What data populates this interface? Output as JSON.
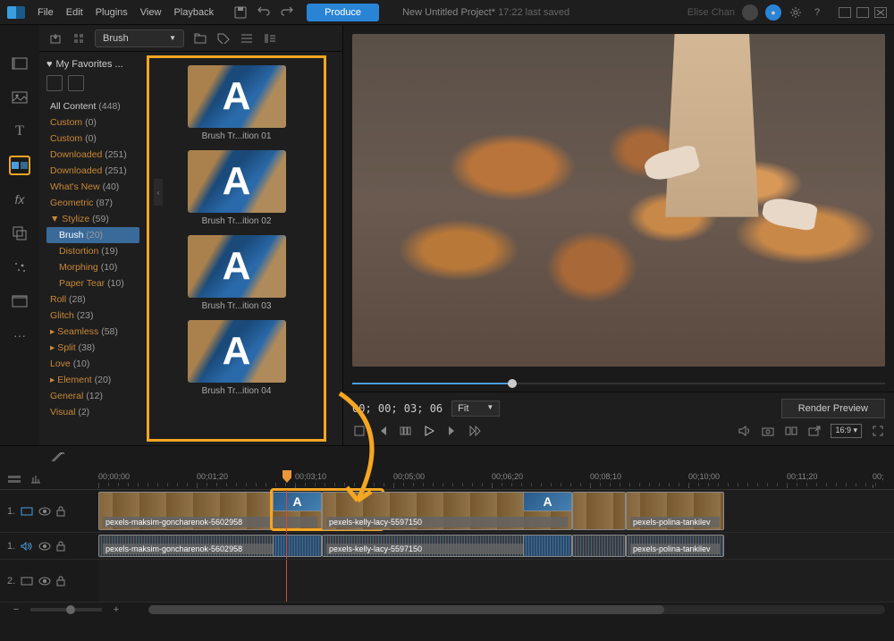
{
  "menubar": {
    "items": [
      "File",
      "Edit",
      "Plugins",
      "View",
      "Playback"
    ],
    "produce": "Produce",
    "title": "New Untitled Project*",
    "saved": "17:22 last saved",
    "user": "Elise Chan"
  },
  "library": {
    "dropdown": "Brush",
    "favorites": "My Favorites ...",
    "all_content": "All Content",
    "all_count": "(448)",
    "categories": [
      {
        "label": "Custom",
        "count": "(0)"
      },
      {
        "label": "Custom",
        "count": "(0)"
      },
      {
        "label": "Downloaded",
        "count": "(251)"
      },
      {
        "label": "Downloaded",
        "count": "(251)"
      },
      {
        "label": "What's New",
        "count": "(40)"
      },
      {
        "label": "Geometric",
        "count": "(87)"
      },
      {
        "label": "▼ Stylize",
        "count": "(59)"
      },
      {
        "label": "Brush",
        "count": "(20)",
        "sub": true,
        "selected": true
      },
      {
        "label": "Distortion",
        "count": "(19)",
        "sub": true
      },
      {
        "label": "Morphing",
        "count": "(10)",
        "sub": true
      },
      {
        "label": "Paper Tear",
        "count": "(10)",
        "sub": true
      },
      {
        "label": "Roll",
        "count": "(28)"
      },
      {
        "label": "Glitch",
        "count": "(23)"
      },
      {
        "label": "▸ Seamless",
        "count": "(58)"
      },
      {
        "label": "▸ Split",
        "count": "(38)"
      },
      {
        "label": "Love",
        "count": "(10)"
      },
      {
        "label": "▸ Element",
        "count": "(20)"
      },
      {
        "label": "General",
        "count": "(12)"
      },
      {
        "label": "Visual",
        "count": "(2)"
      }
    ],
    "transitions": [
      {
        "label": "Brush Tr...ition 01"
      },
      {
        "label": "Brush Tr...ition 02"
      },
      {
        "label": "Brush Tr...ition 03"
      },
      {
        "label": "Brush Tr...ition 04"
      }
    ]
  },
  "preview": {
    "timecode": "00; 00; 03; 06",
    "fit": "Fit",
    "render": "Render Preview",
    "aspect": "16:9"
  },
  "timeline": {
    "marks": [
      "00;00;00",
      "00;01;20",
      "00;03;10",
      "00;05;00",
      "00;06;20",
      "00;08;10",
      "00;10;00",
      "00;11;20",
      "00;"
    ],
    "tracks": [
      {
        "num": "1.",
        "type": "video"
      },
      {
        "num": "1.",
        "type": "audio"
      },
      {
        "num": "2.",
        "type": "video"
      }
    ],
    "clips": {
      "v1": [
        {
          "label": "pexels-maksim-goncharenok-5602958"
        },
        {
          "label": "pexels-kelly-lacy-5597150"
        },
        {
          "label": "pexels-polina-tankilev"
        }
      ],
      "a1": [
        {
          "label": "pexels-maksim-goncharenok-5602958"
        },
        {
          "label": "pexels-kelly-lacy-5597150"
        },
        {
          "label": "pexels-polina-tankilev"
        }
      ]
    }
  }
}
